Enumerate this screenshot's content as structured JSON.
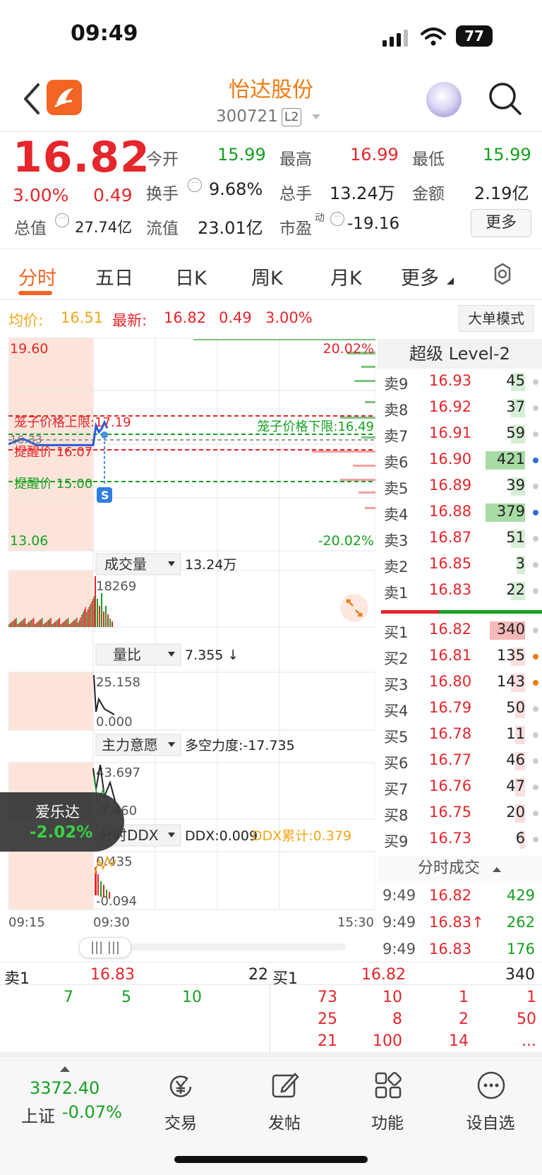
{
  "status": {
    "time": "09:49",
    "battery": "77"
  },
  "header": {
    "name": "怡达股份",
    "code": "300721",
    "badge": "L2"
  },
  "quote": {
    "price": "16.82",
    "change_pct": "3.00%",
    "change_amt": "0.49",
    "open_label": "今开",
    "open": "15.99",
    "high_label": "最高",
    "high": "16.99",
    "low_label": "最低",
    "low": "15.99",
    "turnover_label": "换手",
    "turnover": "9.68%",
    "volume_label": "总手",
    "volume": "13.24万",
    "amount_label": "金额",
    "amount": "2.19亿",
    "mktcap_label": "总值",
    "mktcap": "27.74亿",
    "float_label": "流值",
    "float_cap": "23.01亿",
    "pe_label": "市盈",
    "pe_sup": "动",
    "pe": "-19.16",
    "more": "更多"
  },
  "tabs": [
    "分时",
    "五日",
    "日K",
    "周K",
    "月K",
    "更多"
  ],
  "infobar": {
    "avg_label": "均价:",
    "avg": "16.51",
    "last_label": "最新:",
    "last": "16.82",
    "chg": "0.49",
    "pct": "3.00%",
    "big_order": "大单模式"
  },
  "chart": {
    "y_top": "19.60",
    "y_bottom": "13.06",
    "pct_top": "20.02%",
    "pct_bottom": "-20.02%",
    "upper_limit_label": "笼子价格上限:17.19",
    "lower_limit_label": "笼子价格下限:16.49",
    "alert1": "提醒价 16.07",
    "alert2": "提醒价 15.00",
    "left_partial": "16.33",
    "vol_menu": "成交量",
    "vol_value": "13.24万",
    "vol_peak": "18269",
    "ratio_menu": "量比",
    "ratio_value": "7.355 ↓",
    "ratio_high": "25.158",
    "ratio_low": "0.000",
    "main_menu": "主力意愿",
    "main_value": "多空力度:-17.735",
    "main_high": "43.697",
    "main_low": "-7.460",
    "ddx_menu": "分时DDX",
    "ddx_value": "DDX:0.009",
    "ddx_cum": "DDX累计:0.379",
    "ddx_high": "0.435",
    "ddx_low": "-0.094",
    "time_start": "09:15",
    "time_mid": "09:30",
    "time_end": "15:30"
  },
  "chart_data": {
    "type": "line",
    "x": [
      "09:15",
      "09:20",
      "09:25",
      "09:30",
      "09:32",
      "09:35",
      "09:40",
      "09:45",
      "09:49"
    ],
    "series": [
      {
        "values": [
          16.33,
          16.5,
          16.3,
          16.3,
          16.9,
          16.7,
          16.8,
          17.0,
          16.82
        ]
      }
    ],
    "ylim": [
      13.06,
      19.6
    ],
    "tick_labels": [
      "19.60",
      "13.06",
      "20.02%",
      "-20.02%"
    ],
    "xticks": [
      "09:15",
      "09:30",
      "15:30"
    ],
    "annotations": [
      "笼子价格上限:17.19",
      "笼子价格下限:16.49",
      "提醒价 16.07",
      "提醒价 15.00"
    ],
    "grid": true
  },
  "orderbook": {
    "title": "超级 Level-2",
    "asks": [
      {
        "label": "卖9",
        "price": "16.93",
        "vol": "45"
      },
      {
        "label": "卖8",
        "price": "16.92",
        "vol": "37"
      },
      {
        "label": "卖7",
        "price": "16.91",
        "vol": "59"
      },
      {
        "label": "卖6",
        "price": "16.90",
        "vol": "421"
      },
      {
        "label": "卖5",
        "price": "16.89",
        "vol": "39"
      },
      {
        "label": "卖4",
        "price": "16.88",
        "vol": "379"
      },
      {
        "label": "卖3",
        "price": "16.87",
        "vol": "51"
      },
      {
        "label": "卖2",
        "price": "16.85",
        "vol": "3"
      },
      {
        "label": "卖1",
        "price": "16.83",
        "vol": "22"
      }
    ],
    "bids": [
      {
        "label": "买1",
        "price": "16.82",
        "vol": "340"
      },
      {
        "label": "买2",
        "price": "16.81",
        "vol": "135"
      },
      {
        "label": "买3",
        "price": "16.80",
        "vol": "143"
      },
      {
        "label": "买4",
        "price": "16.79",
        "vol": "50"
      },
      {
        "label": "买5",
        "price": "16.78",
        "vol": "11"
      },
      {
        "label": "买6",
        "price": "16.77",
        "vol": "46"
      },
      {
        "label": "买7",
        "price": "16.76",
        "vol": "47"
      },
      {
        "label": "买8",
        "price": "16.75",
        "vol": "20"
      },
      {
        "label": "买9",
        "price": "16.73",
        "vol": "6"
      }
    ]
  },
  "trades": {
    "title": "分时成交",
    "rows": [
      {
        "time": "9:49",
        "price": "16.82",
        "vol": "429"
      },
      {
        "time": "9:49",
        "price": "16.83↑",
        "vol": "262"
      },
      {
        "time": "9:49",
        "price": "16.83",
        "vol": "176"
      }
    ]
  },
  "float_badge": {
    "name": "爱乐达",
    "pct": "-2.02%"
  },
  "queues": {
    "sell_label": "卖1",
    "sell_price": "16.83",
    "sell_vol": "22",
    "buy_label": "买1",
    "buy_price": "16.82",
    "buy_vol": "340",
    "sell_items": [
      "7",
      "5",
      "10"
    ],
    "buy_row1": [
      "73",
      "10",
      "1",
      "1"
    ],
    "buy_row2": [
      "25",
      "8",
      "2",
      "50"
    ],
    "buy_row3": [
      "21",
      "100",
      "14",
      "..."
    ]
  },
  "bottom_nav": {
    "index_value": "3372.40",
    "index_name": "上证",
    "index_pct": "-0.07%",
    "items": [
      "交易",
      "发帖",
      "功能",
      "设自选"
    ]
  }
}
